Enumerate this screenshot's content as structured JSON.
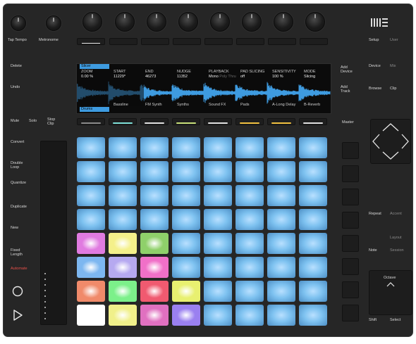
{
  "colors": {
    "body": "#262626",
    "pad_blue": "#7ec2f0",
    "button_white_led": "#e8e8e8",
    "display_waveform": "#3e9be0",
    "display_highlight": "#3e9be0"
  },
  "logo": {
    "icon": "ableton-logo-icon"
  },
  "left_buttons": {
    "tap_tempo": "Tap Tempo",
    "metronome": "Metronome",
    "delete": "Delete",
    "undo": "Undo",
    "mute": "Mute",
    "solo": "Solo",
    "stop_clip": "Stop\nClip",
    "convert": "Convert",
    "double_loop": "Double\nLoop",
    "quantize": "Quantize",
    "duplicate": "Duplicate",
    "new": "New",
    "fixed_length": "Fixed\nLength",
    "automate": "Automate",
    "record_icon": "record-icon",
    "play_icon": "play-icon"
  },
  "right_buttons": {
    "setup": "Setup",
    "user": "User",
    "add_device": "Add\nDevice",
    "add_track": "Add\nTrack",
    "device": "Device",
    "mix": "Mix",
    "browse": "Browse",
    "clip": "Clip",
    "master": "Master",
    "repeat": "Repeat",
    "accent": "Accent",
    "layout": "Layout",
    "note": "Note",
    "session": "Session",
    "octave": "Octave",
    "shift": "Shift",
    "select": "Select"
  },
  "display": {
    "top_tab": "Slicer",
    "zoom_label": "ZOOM",
    "zoom_value": "0.00 %",
    "start_label": "START",
    "start_value": "11229*",
    "end_label": "END",
    "end_value": "46273",
    "nudge_label": "NUDGE",
    "nudge_value": "11352",
    "playback_label": "PLAYBACK",
    "playback_value": "Mono",
    "playback_alt": "Poly Thru",
    "pad_slicing_label": "PAD SLICING",
    "pad_slicing_value": "off",
    "sensitivity_label": "SENSITIVITY",
    "sensitivity_value": "100 %",
    "mode_label": "MODE",
    "mode_value": "Slicing",
    "bottom_tab": "Drums",
    "tracks": [
      "Bassline",
      "FM Synth",
      "Synths",
      "Sound FX",
      "Pads",
      "A-Long Delay",
      "B-Reverb"
    ]
  },
  "pad_grid": {
    "rows": 8,
    "cols": 8,
    "colored": [
      {
        "row": 4,
        "col": 0,
        "color": "#e07be0"
      },
      {
        "row": 4,
        "col": 1,
        "color": "#f4f08a"
      },
      {
        "row": 4,
        "col": 2,
        "color": "#8fd06a"
      },
      {
        "row": 5,
        "col": 0,
        "color": "#7db7f0"
      },
      {
        "row": 5,
        "col": 1,
        "color": "#b6a9f0"
      },
      {
        "row": 5,
        "col": 2,
        "color": "#f070c8"
      },
      {
        "row": 6,
        "col": 0,
        "color": "#f08a6a"
      },
      {
        "row": 6,
        "col": 1,
        "color": "#7cf08a"
      },
      {
        "row": 6,
        "col": 2,
        "color": "#f05a70"
      },
      {
        "row": 6,
        "col": 3,
        "color": "#e8f070"
      },
      {
        "row": 7,
        "col": 0,
        "color": "#ffffff"
      },
      {
        "row": 7,
        "col": 1,
        "color": "#f0f08a"
      },
      {
        "row": 7,
        "col": 2,
        "color": "#e070c0"
      },
      {
        "row": 7,
        "col": 3,
        "color": "#9a80f0"
      }
    ]
  },
  "track_led_colors": [
    "#8a8a8a",
    "#7fe0d8",
    "#e0e0e0",
    "#c8e07a",
    "#e0e0e0",
    "#f0c040",
    "#f0c040",
    "#e0e0e0"
  ]
}
